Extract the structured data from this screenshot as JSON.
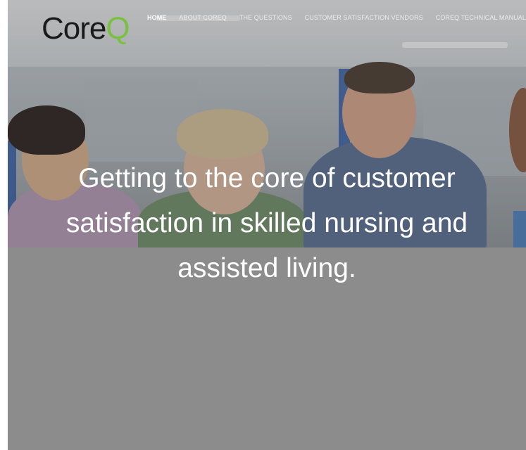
{
  "logo": {
    "text_main": "Core",
    "text_accent": "Q",
    "accent_color": "#7ac142"
  },
  "nav": {
    "items": [
      {
        "label": "HOME",
        "active": true
      },
      {
        "label": "ABOUT COREQ",
        "active": false
      },
      {
        "label": "THE QUESTIONS",
        "active": false
      },
      {
        "label": "CUSTOMER SATISFACTION VENDORS",
        "active": false
      },
      {
        "label": "COREQ TECHNICAL MANUAL",
        "active": false
      }
    ]
  },
  "hero": {
    "headline": "Getting to the core of customer satisfaction in skilled nursing and assisted living.",
    "image": "photo-icon"
  },
  "colors": {
    "page_background": "#8c8c8c",
    "nav_text": "#ececec",
    "headline_text": "#ffffff"
  }
}
